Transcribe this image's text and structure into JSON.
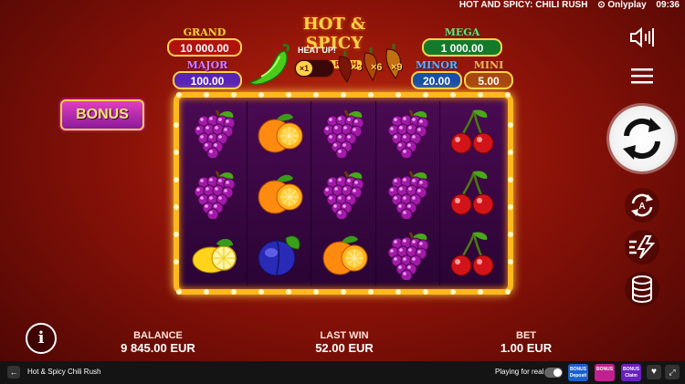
{
  "window": {
    "game_title": "HOT AND SPICY: CHILI RUSH",
    "provider": "⊙ Onlyplay",
    "clock": "09:36"
  },
  "logo": {
    "line1": "HOT & SPICY",
    "line2": "CHILI RUSH"
  },
  "heat": {
    "label": "HEAT UP!",
    "multipliers": [
      "×1",
      "×3",
      "×6",
      "×9"
    ]
  },
  "jackpots": {
    "grand": {
      "label": "GRAND",
      "value": "10 000.00"
    },
    "major": {
      "label": "MAJOR",
      "value": "100.00"
    },
    "mega": {
      "label": "MEGA",
      "value": "1 000.00"
    },
    "minor": {
      "label": "MINOR",
      "value": "20.00"
    },
    "mini": {
      "label": "MINI",
      "value": "5.00"
    }
  },
  "bonus_button": "BONUS",
  "reels": [
    [
      "grapes",
      "grapes",
      "lemon"
    ],
    [
      "orange",
      "orange",
      "plum"
    ],
    [
      "grapes",
      "grapes",
      "orange"
    ],
    [
      "grapes",
      "grapes",
      "grapes"
    ],
    [
      "cherries",
      "cherries",
      "cherries"
    ]
  ],
  "stats": {
    "balance_label": "BALANCE",
    "balance_value": "9 845.00 EUR",
    "last_win_label": "LAST WIN",
    "last_win_value": "52.00 EUR",
    "bet_label": "BET",
    "bet_value": "1.00 EUR"
  },
  "controls": [
    "sound-icon",
    "menu-icon",
    "spin-icon",
    "autoplay-icon",
    "turbo-icon",
    "bet-coins-icon"
  ],
  "bottombar": {
    "back": "←",
    "title": "Hot & Spicy Chili Rush",
    "playing_for_real": "Playing for real",
    "promos": [
      {
        "top": "BONUS",
        "bottom": "Deposit",
        "color": "#1a5fd0"
      },
      {
        "top": "BONUS",
        "bottom": "",
        "color": "#c02090"
      },
      {
        "top": "BONUS",
        "bottom": "Claim",
        "color": "#6a20c0"
      }
    ],
    "heart": "♥",
    "expand": "⤢"
  },
  "colors": {
    "background": "#8a1208",
    "frame_gold": "#ffb820",
    "reel_purple": "#3a0844"
  }
}
